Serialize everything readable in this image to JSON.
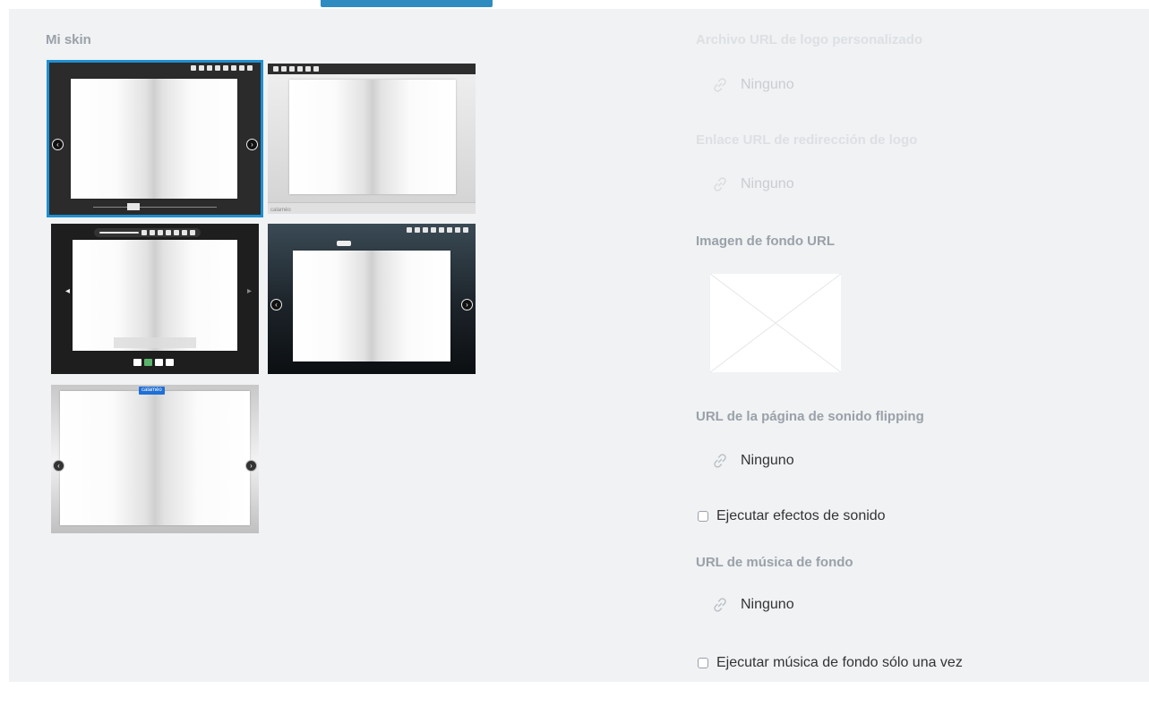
{
  "section": {
    "title": "Mi skin"
  },
  "skins": [
    {
      "id": "skin-1",
      "selected": true
    },
    {
      "id": "skin-2",
      "selected": false,
      "brand": "calaméo"
    },
    {
      "id": "skin-3",
      "selected": false
    },
    {
      "id": "skin-4",
      "selected": false
    },
    {
      "id": "skin-5",
      "selected": false,
      "badge": "calaméo"
    }
  ],
  "settings": {
    "logo_url_label": "Archivo URL de logo personalizado",
    "logo_url_value": "Ninguno",
    "logo_link_label": "Enlace URL de redirección de logo",
    "logo_link_value": "Ninguno",
    "bg_image_label": "Imagen de fondo URL",
    "flip_sound_label": "URL de la página de sonido flipping",
    "flip_sound_value": "Ninguno",
    "play_sound_label": "Ejecutar efectos de sonido",
    "music_label": "URL de música de fondo",
    "music_value": "Ninguno",
    "music_once_label": "Ejecutar música de fondo sólo una vez"
  },
  "colors": {
    "accent": "#1f8fd0",
    "panel_bg": "#f0f2f4",
    "label": "#9aa1a8"
  },
  "icons": {
    "link": "link-icon",
    "image_placeholder": "image-placeholder-icon"
  }
}
